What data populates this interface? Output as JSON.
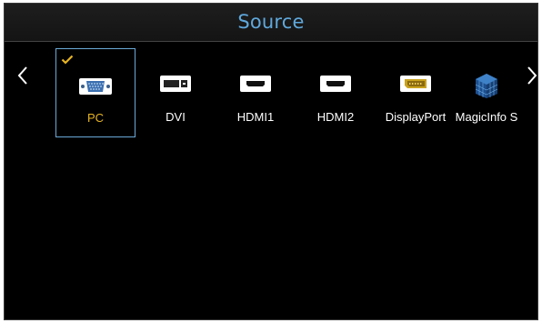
{
  "header": {
    "title": "Source"
  },
  "nav": {
    "prev_icon": "chevron-left-icon",
    "next_icon": "chevron-right-icon"
  },
  "sources": [
    {
      "label": "PC",
      "icon": "vga-port-icon",
      "selected": true
    },
    {
      "label": "DVI",
      "icon": "dvi-port-icon",
      "selected": false
    },
    {
      "label": "HDMI1",
      "icon": "hdmi-port-icon",
      "selected": false
    },
    {
      "label": "HDMI2",
      "icon": "hdmi-port-icon",
      "selected": false
    },
    {
      "label": "DisplayPort",
      "icon": "displayport-icon",
      "selected": false
    },
    {
      "label": "MagicInfo S",
      "icon": "magicinfo-icon",
      "selected": false
    }
  ],
  "colors": {
    "title": "#5fa8dc",
    "selected_text": "#e6b322",
    "selection_border": "#6aa9d8",
    "background": "#000000"
  }
}
